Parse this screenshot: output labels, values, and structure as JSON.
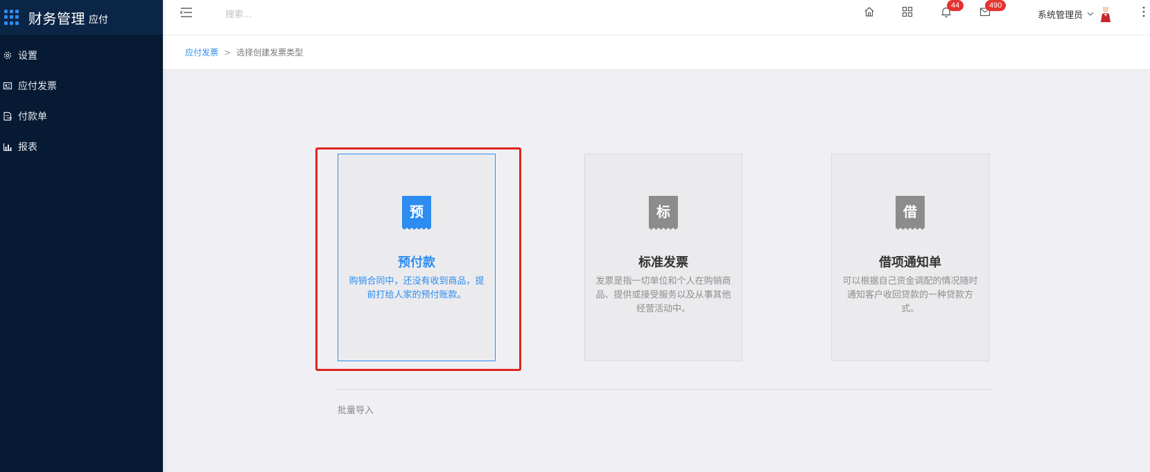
{
  "brand": {
    "title": "财务管理",
    "subtitle": "应付"
  },
  "sidebar": {
    "items": [
      {
        "label": "设置",
        "icon": "gear-icon"
      },
      {
        "label": "应付发票",
        "icon": "invoice-icon"
      },
      {
        "label": "付款单",
        "icon": "payment-doc-icon"
      },
      {
        "label": "报表",
        "icon": "bar-chart-icon"
      }
    ]
  },
  "header": {
    "search_placeholder": "搜索...",
    "notifications_badge": "44",
    "messages_badge": "490",
    "user_name": "系统管理员"
  },
  "breadcrumb": {
    "parent": "应付发票",
    "separator": ">",
    "current": "选择创建发票类型"
  },
  "cards": [
    {
      "icon_char": "预",
      "title": "预付款",
      "description": "购销合同中，还没有收到商品，提前打给人家的预付账款。",
      "selected": true
    },
    {
      "icon_char": "标",
      "title": "标准发票",
      "description": "发票是指一切单位和个人在购销商品、提供或接受服务以及从事其他经营活动中。",
      "selected": false
    },
    {
      "icon_char": "借",
      "title": "借项通知单",
      "description": "可以根据自己资金调配的情况随时通知客户收回贷款的一种贷款方式。",
      "selected": false
    }
  ],
  "batch_import_label": "批量导入",
  "colors": {
    "accent": "#2d8cf0",
    "sidebar_bg": "#061a33",
    "badge": "#e3332f",
    "highlight": "#e0231b",
    "icon_gray": "#8c8c8c"
  }
}
